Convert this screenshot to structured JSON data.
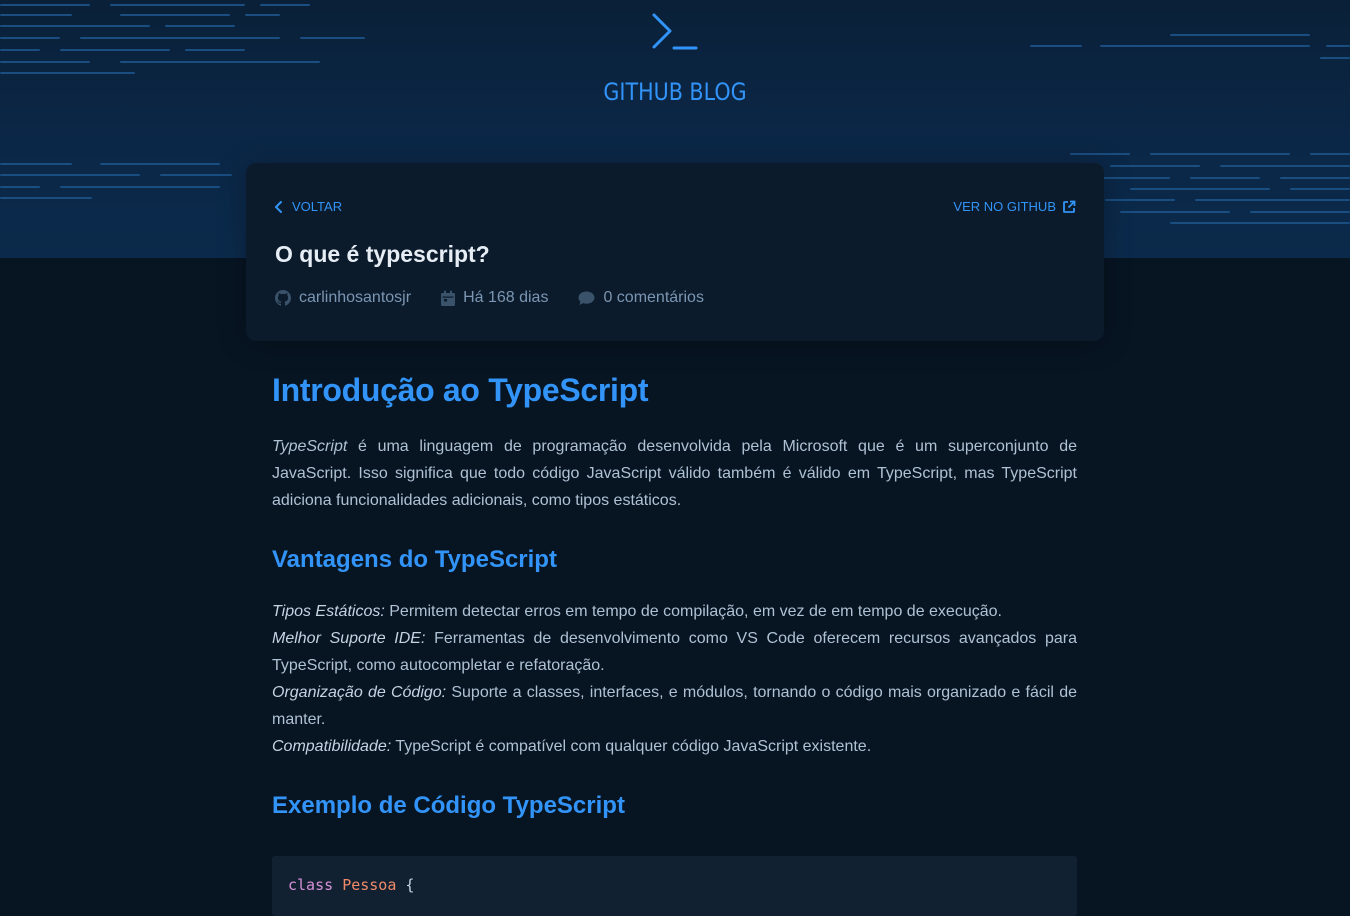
{
  "header": {
    "brand": "GITHUB BLOG",
    "logo_icon": "terminal-icon"
  },
  "post_card": {
    "back_label": "VOLTAR",
    "github_label": "VER NO GITHUB",
    "title": "O que é typescript?",
    "author": "carlinhosantosjr",
    "date": "Há 168 dias",
    "comments": "0 comentários"
  },
  "article": {
    "h1": "Introdução ao TypeScript",
    "intro_em": "TypeScript",
    "intro_text": " é uma linguagem de programação desenvolvida pela Microsoft que é um superconjunto de JavaScript. Isso significa que todo código JavaScript válido também é válido em TypeScript, mas TypeScript adiciona funcionalidades adicionais, como tipos estáticos.",
    "h2_advantages": "Vantagens do TypeScript",
    "advantages": [
      {
        "term": "Tipos Estáticos:",
        "desc": " Permitem detectar erros em tempo de compilação, em vez de em tempo de execução."
      },
      {
        "term": "Melhor Suporte IDE:",
        "desc": " Ferramentas de desenvolvimento como VS Code oferecem recursos avançados para TypeScript, como autocompletar e refatoração."
      },
      {
        "term": "Organização de Código:",
        "desc": " Suporte a classes, interfaces, e módulos, tornando o código mais organizado e fácil de manter."
      },
      {
        "term": "Compatibilidade:",
        "desc": " TypeScript é compatível com qualquer código JavaScript existente."
      }
    ],
    "h2_example": "Exemplo de Código TypeScript",
    "code": {
      "keyword": "class",
      "name": "Pessoa",
      "brace": "{"
    }
  },
  "colors": {
    "accent": "#3294f8",
    "background": "#071422",
    "card": "#0b1b2b"
  }
}
